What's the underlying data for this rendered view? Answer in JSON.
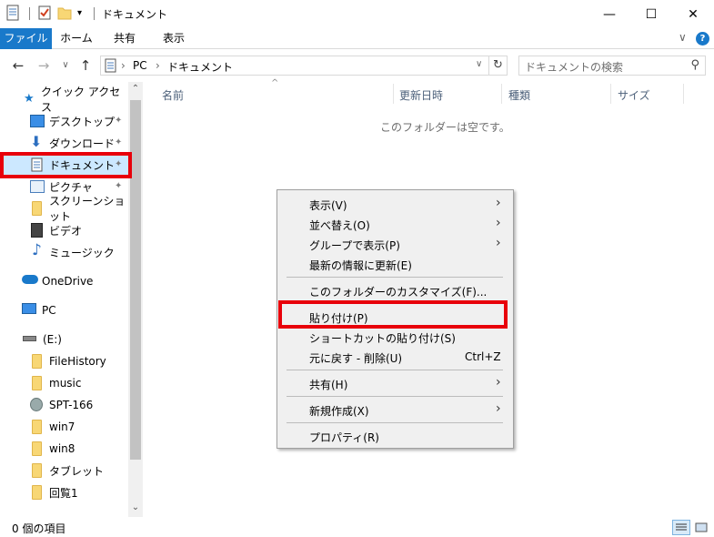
{
  "window": {
    "title": "ドキュメント",
    "minimize": "—",
    "maximize": "☐",
    "close": "✕"
  },
  "ribbon": {
    "tabs": [
      "ファイル",
      "ホーム",
      "共有",
      "表示"
    ],
    "collapse": "∨",
    "help": "?"
  },
  "address": {
    "back": "←",
    "forward": "→",
    "recent": "∨",
    "up": "↑",
    "crumbs": [
      "PC",
      "ドキュメント"
    ],
    "separator": "›",
    "dropdown": "∨",
    "refresh": "↻",
    "search_placeholder": "ドキュメントの検索"
  },
  "nav": {
    "quick_access": "クイック アクセス",
    "items": [
      {
        "label": "デスクトップ",
        "icon": "desktop-icon",
        "pinned": true
      },
      {
        "label": "ダウンロード",
        "icon": "download-icon",
        "pinned": true
      },
      {
        "label": "ドキュメント",
        "icon": "document-icon",
        "pinned": true
      },
      {
        "label": "ピクチャ",
        "icon": "pictures-icon",
        "pinned": true
      },
      {
        "label": "スクリーンショット",
        "icon": "folder-icon",
        "pinned": false
      },
      {
        "label": "ビデオ",
        "icon": "video-icon",
        "pinned": false
      },
      {
        "label": "ミュージック",
        "icon": "music-icon",
        "pinned": false
      }
    ],
    "onedrive": "OneDrive",
    "pc": "PC",
    "drive": "(E:)",
    "drive_items": [
      {
        "label": "FileHistory",
        "icon": "folder-icon"
      },
      {
        "label": "music",
        "icon": "folder-icon"
      },
      {
        "label": "SPT-166",
        "icon": "network-folder-icon"
      },
      {
        "label": "win7",
        "icon": "folder-icon"
      },
      {
        "label": "win8",
        "icon": "folder-icon"
      },
      {
        "label": "タブレット",
        "icon": "folder-icon"
      },
      {
        "label": "回覧1",
        "icon": "folder-icon"
      }
    ],
    "pin_glyph": "📌"
  },
  "columns": {
    "name": "名前",
    "modified": "更新日時",
    "type": "種類",
    "size": "サイズ",
    "sort_glyph": "^"
  },
  "empty_message": "このフォルダーは空です。",
  "context_menu": {
    "items": [
      {
        "label": "表示(V)",
        "submenu": true
      },
      {
        "label": "並べ替え(O)",
        "submenu": true
      },
      {
        "label": "グループで表示(P)",
        "submenu": true
      },
      {
        "label": "最新の情報に更新(E)",
        "submenu": false
      },
      {
        "label": "このフォルダーのカスタマイズ(F)...",
        "submenu": false
      },
      {
        "label": "貼り付け(P)",
        "submenu": false
      },
      {
        "label": "ショートカットの貼り付け(S)",
        "submenu": false
      },
      {
        "label": "元に戻す - 削除(U)",
        "submenu": false,
        "shortcut": "Ctrl+Z"
      },
      {
        "label": "共有(H)",
        "submenu": true
      },
      {
        "label": "新規作成(X)",
        "submenu": true
      },
      {
        "label": "プロパティ(R)",
        "submenu": false
      }
    ],
    "arrow": "›"
  },
  "status": {
    "count": "0 個の項目"
  },
  "colors": {
    "file_tab": "#1979ca",
    "highlight": "#e8000a",
    "menu_bg": "#f0f0f0"
  }
}
